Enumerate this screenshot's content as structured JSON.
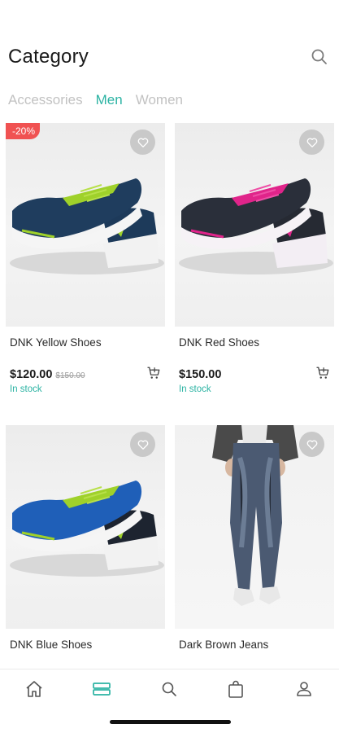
{
  "header": {
    "title": "Category"
  },
  "tabs": [
    {
      "label": "Accessories",
      "active": false
    },
    {
      "label": "Men",
      "active": true
    },
    {
      "label": "Women",
      "active": false
    }
  ],
  "products": [
    {
      "name": "DNK Yellow Shoes",
      "price": "$120.00",
      "old_price": "$150.00",
      "stock": "In stock",
      "badge": "-20%"
    },
    {
      "name": "DNK Red Shoes",
      "price": "$150.00",
      "stock": "In stock"
    },
    {
      "name": "DNK Blue Shoes"
    },
    {
      "name": "Dark Brown Jeans"
    }
  ],
  "bottom_nav": [
    {
      "icon": "home-icon",
      "active": false
    },
    {
      "icon": "category-icon",
      "active": true
    },
    {
      "icon": "search-icon",
      "active": false
    },
    {
      "icon": "bag-icon",
      "active": false
    },
    {
      "icon": "profile-icon",
      "active": false
    }
  ],
  "colors": {
    "accent": "#2bb3a3",
    "badge": "#f05252"
  }
}
